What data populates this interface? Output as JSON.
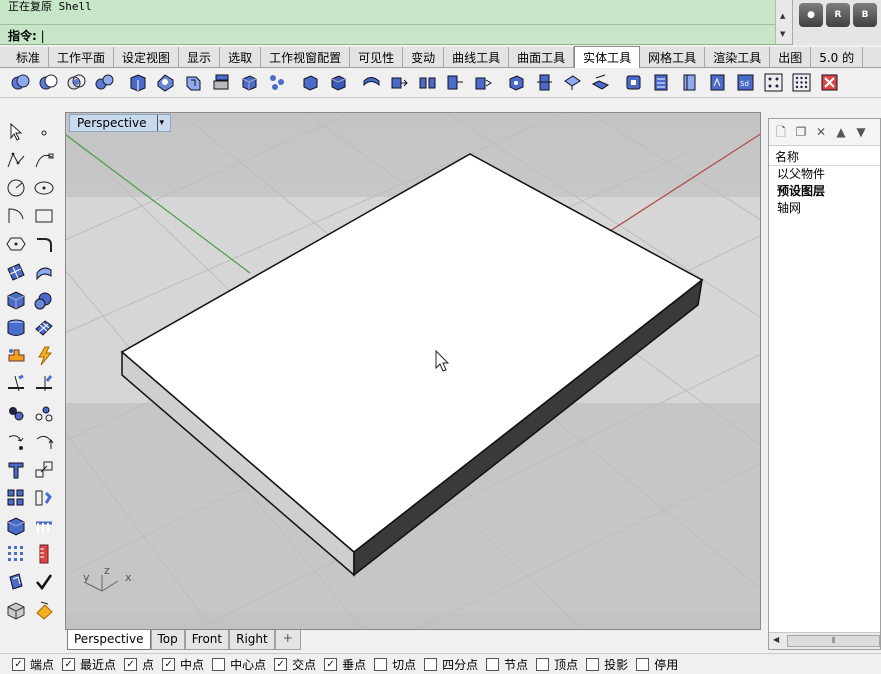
{
  "command": {
    "history_text": "正在复原 Shell",
    "prompt_label": "指令:",
    "input_value": "|"
  },
  "render_icons": {
    "r_label": "R",
    "b_label": "B"
  },
  "ribbon_tabs": [
    "标准",
    "工作平面",
    "设定视图",
    "显示",
    "选取",
    "工作视窗配置",
    "可见性",
    "变动",
    "曲线工具",
    "曲面工具",
    "实体工具",
    "网格工具",
    "渲染工具",
    "出图",
    "5.0 的"
  ],
  "active_ribbon_tab": "实体工具",
  "viewport": {
    "title": "Perspective",
    "dropdown_arrow": "▾",
    "axis_y": "y",
    "axis_z": "z",
    "axis_x": "x"
  },
  "viewport_tabs": [
    "Perspective",
    "Top",
    "Front",
    "Right"
  ],
  "add_tab_label": "+",
  "layers_panel": {
    "header": "名称",
    "items": [
      {
        "label": "以父物件",
        "bold": false
      },
      {
        "label": "预设图层",
        "bold": true
      },
      {
        "label": "轴网",
        "bold": false
      }
    ]
  },
  "osnaps": [
    {
      "label": "端点",
      "checked": true
    },
    {
      "label": "最近点",
      "checked": true
    },
    {
      "label": "点",
      "checked": true
    },
    {
      "label": "中点",
      "checked": true
    },
    {
      "label": "中心点",
      "checked": false
    },
    {
      "label": "交点",
      "checked": true
    },
    {
      "label": "垂点",
      "checked": true
    },
    {
      "label": "切点",
      "checked": false
    },
    {
      "label": "四分点",
      "checked": false
    },
    {
      "label": "节点",
      "checked": false
    },
    {
      "label": "顶点",
      "checked": false
    },
    {
      "label": "投影",
      "checked": false
    },
    {
      "label": "停用",
      "checked": false
    }
  ],
  "colors": {
    "command_bg": "#c7e6c7",
    "viewport_bg": "#c8c8c8",
    "grid_line": "#bababa",
    "x_axis": "#b44a4a",
    "y_axis": "#4aa04a",
    "box_top": "#ffffff",
    "box_side_light": "#d0d0d0",
    "box_side_dark": "#3a3a3a"
  }
}
